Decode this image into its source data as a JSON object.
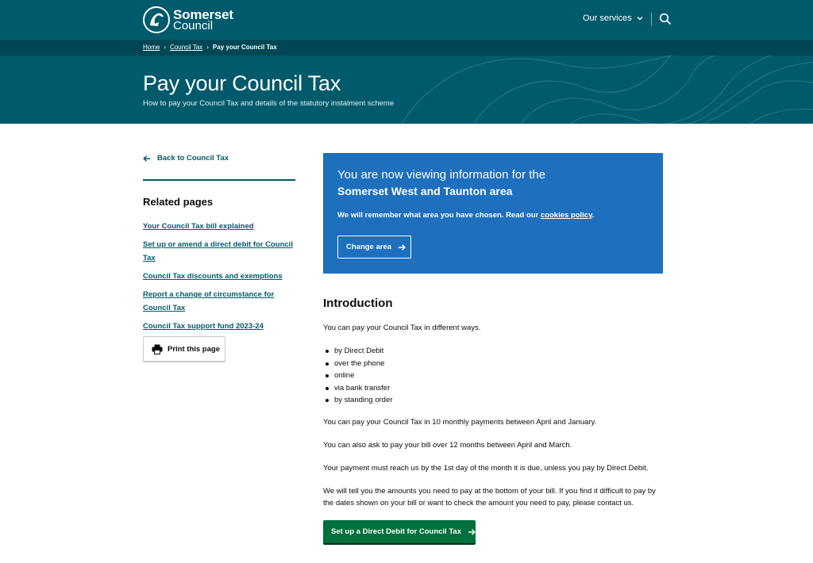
{
  "header": {
    "logo_line1": "Somerset",
    "logo_line2": "Council",
    "services_label": "Our services",
    "search_icon": "search-icon"
  },
  "breadcrumb": {
    "items": [
      "Home",
      "Council Tax"
    ],
    "current": "Pay your Council Tax"
  },
  "hero": {
    "title": "Pay your Council Tax",
    "subtitle": "How to pay your Council Tax and details of the statutory instalment scheme"
  },
  "sidebar": {
    "back_label": "Back to Council Tax",
    "related_heading": "Related pages",
    "related_links": [
      "Your Council Tax bill explained",
      "Set up or amend a direct debit for Council Tax",
      "Council Tax discounts and exemptions",
      "Report a change of circumstance for Council Tax",
      "Council Tax support fund 2023-24"
    ],
    "print_label": "Print this page"
  },
  "area_notice": {
    "line1": "You are now viewing information for the",
    "line2": "Somerset West and Taunton area",
    "remember_text": "We will remember what area you have chosen. Read our ",
    "cookies_link": "cookies policy",
    "remember_end": ".",
    "change_button": "Change area"
  },
  "content": {
    "heading": "Introduction",
    "p1": "You can pay your Council Tax in different ways.",
    "bullets": [
      "by Direct Debit",
      "over the phone",
      "online",
      "via bank transfer",
      "by standing order"
    ],
    "p2": "You can pay your Council Tax in 10 monthly payments between April and January.",
    "p3": "You can also ask to pay your bill over 12 months between April and March.",
    "p4": "Your payment must reach us by the 1st day of the month it is due, unless you pay by Direct Debit.",
    "p5": "We will tell you the amounts you need to pay at the bottom of your bill. If you find it difficult to pay by the dates shown on your bill or want to check the amount you need to pay, please contact us.",
    "cta_button": "Set up a Direct Debit for Council Tax"
  },
  "colors": {
    "brand_teal": "#005a6b",
    "breadcrumb_bg": "#004755",
    "notice_blue": "#1e6fbd",
    "cta_green": "#00703c"
  }
}
